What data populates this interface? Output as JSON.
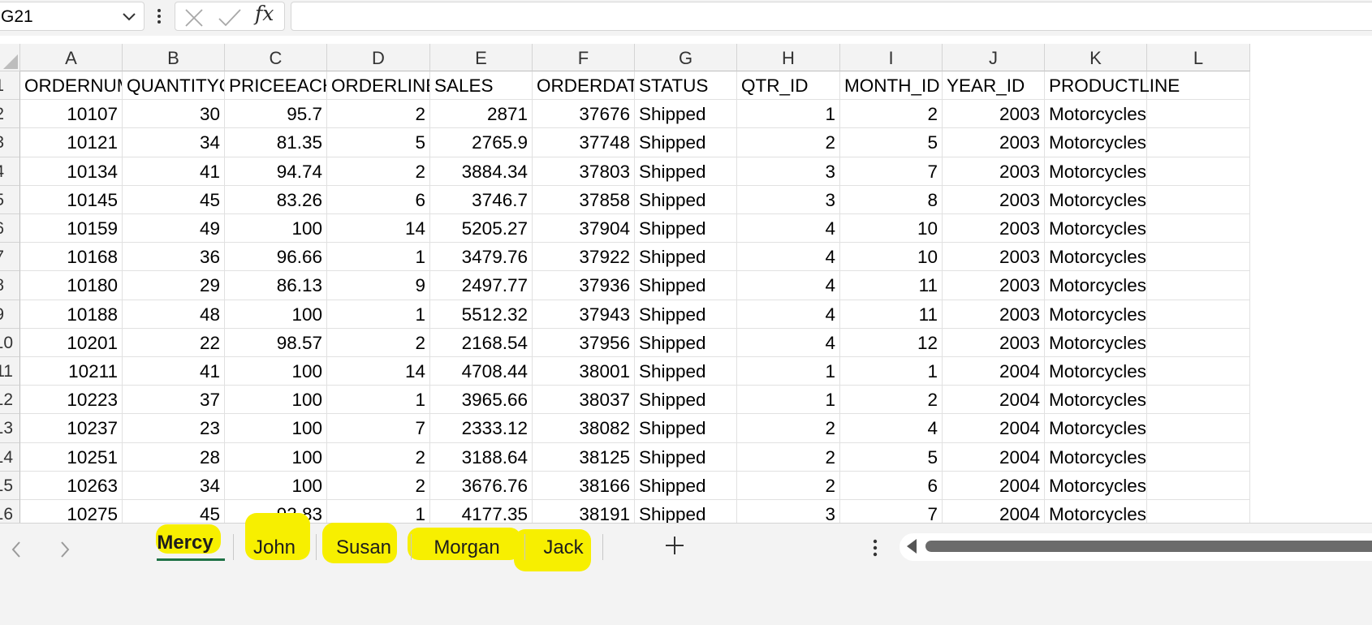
{
  "name_box": {
    "value": "G21"
  },
  "formula_bar": {
    "fx_label": "fx",
    "value": ""
  },
  "columns": [
    "A",
    "B",
    "C",
    "D",
    "E",
    "F",
    "G",
    "H",
    "I",
    "J",
    "K",
    "L"
  ],
  "row_numbers": [
    "1",
    "2",
    "3",
    "4",
    "5",
    "6",
    "7",
    "8",
    "9",
    "10",
    "11",
    "12",
    "13",
    "14",
    "15",
    "16"
  ],
  "header_row": [
    "ORDERNUMBER",
    "QUANTITYORDERED",
    "PRICEEACH",
    "ORDERLINENUMBER",
    "SALES",
    "ORDERDATE",
    "STATUS",
    "QTR_ID",
    "MONTH_ID",
    "YEAR_ID",
    "PRODUCTLINE",
    ""
  ],
  "rows": [
    [
      "10107",
      "30",
      "95.7",
      "2",
      "2871",
      "37676",
      "Shipped",
      "1",
      "2",
      "2003",
      "Motorcycles"
    ],
    [
      "10121",
      "34",
      "81.35",
      "5",
      "2765.9",
      "37748",
      "Shipped",
      "2",
      "5",
      "2003",
      "Motorcycles"
    ],
    [
      "10134",
      "41",
      "94.74",
      "2",
      "3884.34",
      "37803",
      "Shipped",
      "3",
      "7",
      "2003",
      "Motorcycles"
    ],
    [
      "10145",
      "45",
      "83.26",
      "6",
      "3746.7",
      "37858",
      "Shipped",
      "3",
      "8",
      "2003",
      "Motorcycles"
    ],
    [
      "10159",
      "49",
      "100",
      "14",
      "5205.27",
      "37904",
      "Shipped",
      "4",
      "10",
      "2003",
      "Motorcycles"
    ],
    [
      "10168",
      "36",
      "96.66",
      "1",
      "3479.76",
      "37922",
      "Shipped",
      "4",
      "10",
      "2003",
      "Motorcycles"
    ],
    [
      "10180",
      "29",
      "86.13",
      "9",
      "2497.77",
      "37936",
      "Shipped",
      "4",
      "11",
      "2003",
      "Motorcycles"
    ],
    [
      "10188",
      "48",
      "100",
      "1",
      "5512.32",
      "37943",
      "Shipped",
      "4",
      "11",
      "2003",
      "Motorcycles"
    ],
    [
      "10201",
      "22",
      "98.57",
      "2",
      "2168.54",
      "37956",
      "Shipped",
      "4",
      "12",
      "2003",
      "Motorcycles"
    ],
    [
      "10211",
      "41",
      "100",
      "14",
      "4708.44",
      "38001",
      "Shipped",
      "1",
      "1",
      "2004",
      "Motorcycles"
    ],
    [
      "10223",
      "37",
      "100",
      "1",
      "3965.66",
      "38037",
      "Shipped",
      "1",
      "2",
      "2004",
      "Motorcycles"
    ],
    [
      "10237",
      "23",
      "100",
      "7",
      "2333.12",
      "38082",
      "Shipped",
      "2",
      "4",
      "2004",
      "Motorcycles"
    ],
    [
      "10251",
      "28",
      "100",
      "2",
      "3188.64",
      "38125",
      "Shipped",
      "2",
      "5",
      "2004",
      "Motorcycles"
    ],
    [
      "10263",
      "34",
      "100",
      "2",
      "3676.76",
      "38166",
      "Shipped",
      "2",
      "6",
      "2004",
      "Motorcycles"
    ],
    [
      "10275",
      "45",
      "92.83",
      "1",
      "4177.35",
      "38191",
      "Shipped",
      "3",
      "7",
      "2004",
      "Motorcycles"
    ]
  ],
  "sheet_tabs": [
    {
      "label": "Mercy",
      "active": true
    },
    {
      "label": "John",
      "active": false
    },
    {
      "label": "Susan",
      "active": false
    },
    {
      "label": "Morgan",
      "active": false
    },
    {
      "label": "Jack",
      "active": false
    }
  ],
  "colors": {
    "highlight": "#f7ef00",
    "active_tab_underline": "#1e7145",
    "header_bg": "#f3f3f3"
  },
  "icons": [
    "chevron-down-icon",
    "more-vertical-icon",
    "cancel-icon",
    "confirm-icon",
    "function-icon",
    "select-all-icon",
    "scroll-left-icon",
    "scroll-right-icon",
    "add-sheet-icon",
    "more-options-icon",
    "scroll-left-arrow-icon"
  ]
}
